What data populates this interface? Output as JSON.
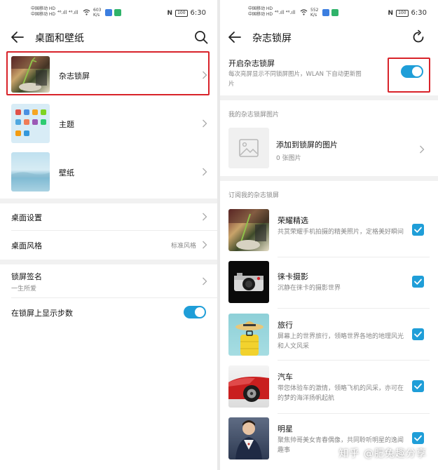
{
  "left": {
    "status": {
      "carrier1": "中国移动 HD",
      "carrier2": "中国移动 HD",
      "signal": "⁴⁶.ıll ⁴⁶.ıll",
      "speed_value": "603",
      "speed_unit": "K/s",
      "nfc": "N",
      "battery": "100",
      "time": "6:30"
    },
    "header": {
      "title": "桌面和壁纸"
    },
    "items": {
      "magazine_lock": "杂志锁屏",
      "theme": "主题",
      "wallpaper": "壁纸",
      "desktop_settings": "桌面设置",
      "desktop_style": "桌面风格",
      "desktop_style_value": "标准风格",
      "lock_signature": "锁屏签名",
      "lock_signature_value": "一生所爱",
      "show_steps": "在锁屏上显示步数"
    }
  },
  "right": {
    "status": {
      "carrier1": "中国移动 HD",
      "carrier2": "中国移动 HD",
      "signal": "⁴⁶.ıll ⁴⁶.ıll",
      "speed_value": "552",
      "speed_unit": "K/s",
      "nfc": "N",
      "battery": "100",
      "time": "6:30"
    },
    "header": {
      "title": "杂志锁屏"
    },
    "enable": {
      "label": "开启杂志锁屏",
      "desc_line1": "每次亮屏显示不同锁屏图片，WLAN 下自动更新图",
      "desc_line2": "片"
    },
    "my_pictures": {
      "section": "我的杂志锁屏图片",
      "add_label": "添加到锁屏的图片",
      "count": "0 张图片"
    },
    "subscribed": {
      "section": "订阅我的杂志锁屏",
      "items": [
        {
          "title": "荣耀精选",
          "desc": "共赏荣耀手机拍摄的精美照片，定格美好瞬间"
        },
        {
          "title": "徕卡摄影",
          "desc": "沉静在徕卡的摄影世界"
        },
        {
          "title": "旅行",
          "desc": "屏幕上的世界旅行，领略世界各地的地理风光和人文风采"
        },
        {
          "title": "汽车",
          "desc": "带您体验车的激情，领略飞机的风采，亦可在的梦的海洋扬帆起航"
        },
        {
          "title": "明星",
          "desc": "聚焦帅哥美女青春偶像，共同聆听明星的逸闻趣事"
        }
      ]
    }
  },
  "watermark": "知乎 @肥兔趣分享",
  "colors": {
    "accent": "#1f9ed8",
    "highlight": "#d8232a"
  },
  "icons": [
    "back-arrow-icon",
    "search-icon",
    "refresh-icon",
    "chevron-right-icon",
    "image-placeholder-icon",
    "checkbox-checked-icon"
  ]
}
